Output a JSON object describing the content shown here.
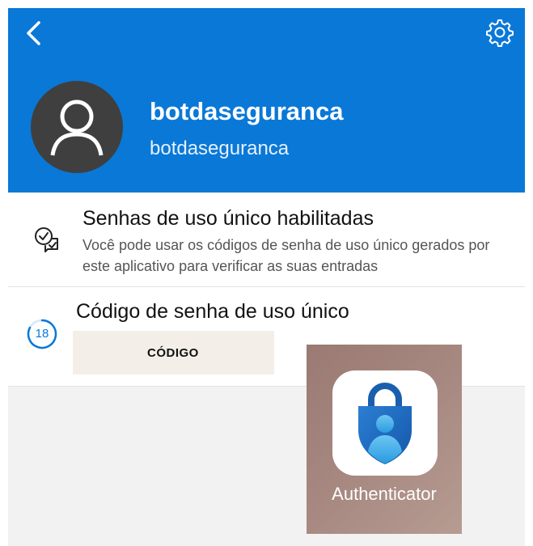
{
  "header": {
    "title": "botdaseguranca",
    "subtitle": "botdaseguranca",
    "background_color": "#0a78d7",
    "back_icon": "chevron-left-icon",
    "settings_icon": "gear-icon"
  },
  "one_time_passwords": {
    "title": "Senhas de uso único habilitadas",
    "description": "Você pode usar os códigos de senha de uso único gerados por este aplicativo para verificar as suas entradas",
    "icon": "check-chat-icon"
  },
  "otp_code": {
    "title": "Código de senha de uso único",
    "timer_value": "18",
    "code_label": "CÓDIGO",
    "accent_color": "#0a78d7"
  },
  "app_overlay": {
    "app_name": "Authenticator",
    "icon": "authenticator-lock-icon"
  }
}
